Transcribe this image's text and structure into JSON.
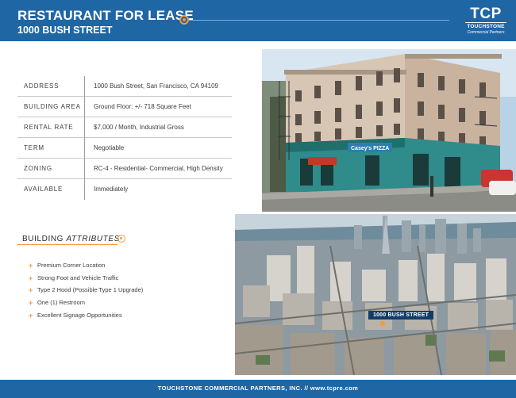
{
  "header": {
    "title": "RESTAURANT FOR LEASE",
    "subtitle": "1000 BUSH STREET"
  },
  "logo": {
    "initials": "TCP",
    "name": "TOUCHSTONE",
    "tagline": "Commercial Partners"
  },
  "property": [
    {
      "label": "ADDRESS",
      "value": "1000 Bush Street, San Francisco, CA  94109"
    },
    {
      "label": "BUILDING AREA",
      "value": "Ground Floor:  +/- 718 Square Feet"
    },
    {
      "label": "RENTAL RATE",
      "value": "$7,000 / Month, Industrial Gross"
    },
    {
      "label": "TERM",
      "value": "Negotiable"
    },
    {
      "label": "ZONING",
      "value": "RC-4 - Residential- Commercial, High Density"
    },
    {
      "label": "AVAILABLE",
      "value": "Immediately"
    }
  ],
  "attributes": {
    "heading_plain": "BUILDING",
    "heading_italic": "ATTRIBUTES",
    "items": [
      "Premium Corner Location",
      "Strong Foot and Vehicle Traffic",
      "Type 2 Hood (Possible Type 1 Upgrade)",
      "One (1) Restroom",
      "Excellent Signage Opportunities"
    ]
  },
  "photo": {
    "aerial_label": "1000 BUSH STREET",
    "storefront_sign": "Casey's PIZZA"
  },
  "footer": {
    "text": "TOUCHSTONE COMMERCIAL PARTNERS, INC.  //  www.tcpre.com"
  },
  "colors": {
    "brand_blue": "#1f66a5",
    "accent_orange": "#f29a3a"
  }
}
